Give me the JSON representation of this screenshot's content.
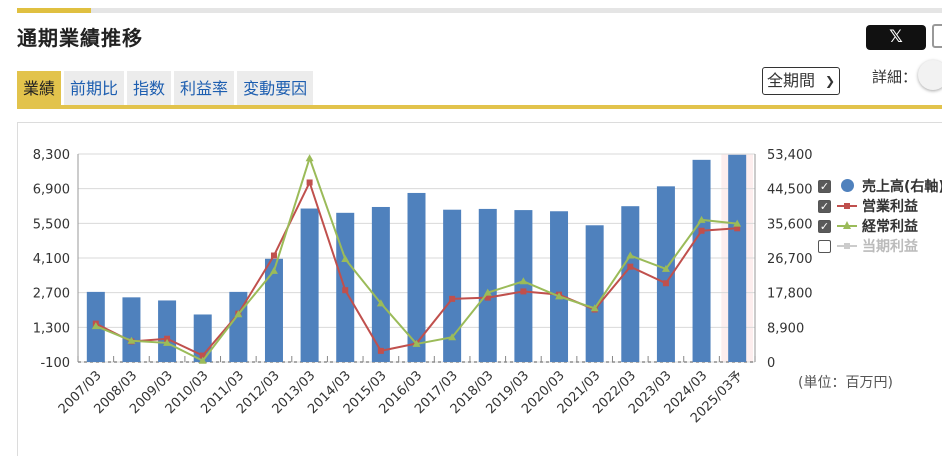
{
  "header": {
    "title": "通期業績推移",
    "x_label": "𝕏"
  },
  "tabs": [
    {
      "label": "業績",
      "active": true
    },
    {
      "label": "前期比",
      "active": false
    },
    {
      "label": "指数",
      "active": false
    },
    {
      "label": "利益率",
      "active": false
    },
    {
      "label": "変動要因",
      "active": false
    }
  ],
  "controls": {
    "period": "全期間",
    "detail_label": "詳細："
  },
  "unit_label": "(単位：百万円)",
  "legend": [
    {
      "label": "売上高(右軸)",
      "checked": true
    },
    {
      "label": "営業利益",
      "checked": true
    },
    {
      "label": "経常利益",
      "checked": true
    },
    {
      "label": "当期利益",
      "checked": false
    }
  ],
  "chart_data": {
    "type": "bar",
    "categories": [
      "2007/03",
      "2008/03",
      "2009/03",
      "2010/03",
      "2011/03",
      "2012/03",
      "2013/03",
      "2014/03",
      "2015/03",
      "2016/03",
      "2017/03",
      "2018/03",
      "2019/03",
      "2020/03",
      "2021/03",
      "2022/03",
      "2023/03",
      "2024/03",
      "2025/03予"
    ],
    "left_axis": {
      "ylim": [
        -100,
        8300
      ],
      "ticks": [
        "8,300",
        "6,900",
        "5,500",
        "4,100",
        "2,700",
        "1,300",
        "-100"
      ]
    },
    "right_axis": {
      "ylim": [
        0,
        53400
      ],
      "ticks": [
        "53,400",
        "44,500",
        "35,600",
        "26,700",
        "17,800",
        "8,900",
        "0"
      ]
    },
    "series": [
      {
        "name": "売上高(右軸)",
        "type": "bar",
        "axis": "right",
        "color": "#4f81bd",
        "values": [
          18000,
          16600,
          15800,
          12200,
          18000,
          26500,
          39400,
          38300,
          39800,
          43400,
          39100,
          39300,
          39000,
          38700,
          35100,
          40000,
          45100,
          51900,
          53200
        ]
      },
      {
        "name": "営業利益",
        "type": "line",
        "axis": "left",
        "color": "#c0504d",
        "values": [
          1450,
          730,
          840,
          160,
          1850,
          4200,
          7150,
          2800,
          350,
          650,
          2450,
          2500,
          2750,
          2620,
          2020,
          3750,
          3080,
          5200,
          5300
        ]
      },
      {
        "name": "経常利益",
        "type": "line",
        "axis": "left",
        "color": "#9bbb59",
        "values": [
          1350,
          760,
          670,
          -50,
          1830,
          3580,
          8130,
          4060,
          2270,
          630,
          900,
          2700,
          3160,
          2550,
          2070,
          4200,
          3660,
          5640,
          5490
        ]
      },
      {
        "name": "当期利益",
        "type": "line",
        "axis": "left",
        "color": "#cccccc",
        "visible": false,
        "values": []
      }
    ],
    "forecast_highlight": "2025/03予",
    "grid": true
  }
}
